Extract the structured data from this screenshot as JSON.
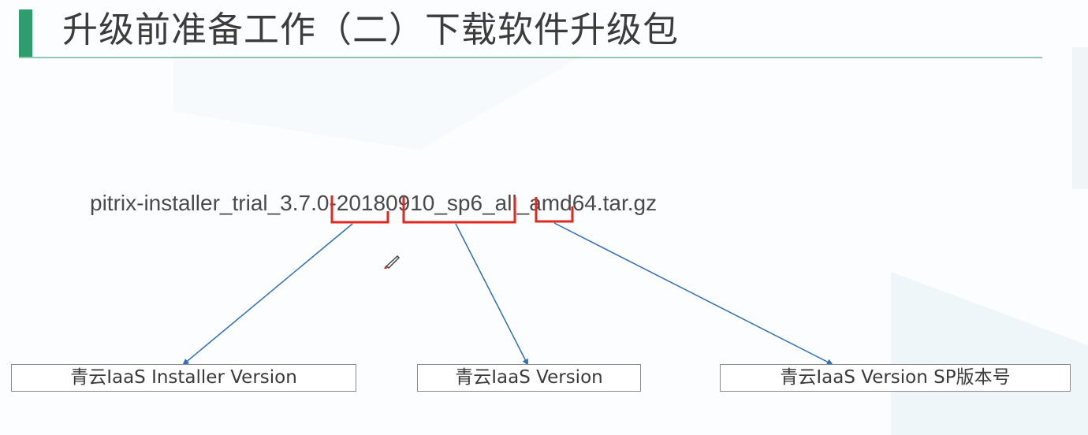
{
  "header": {
    "title": "升级前准备工作（二）下载软件升级包"
  },
  "main": {
    "filename": "pitrix-installer_trial_3.7.0-20180910_sp6_all_amd64.tar.gz",
    "labels": [
      "青云IaaS Installer Version",
      "青云IaaS Version",
      "青云IaaS Version SP版本号"
    ]
  },
  "icons": {
    "cursor": "pen-icon"
  },
  "colors": {
    "accent": "#2f9e6e",
    "bracket": "#e0281e",
    "connector": "#2f6fb5"
  }
}
